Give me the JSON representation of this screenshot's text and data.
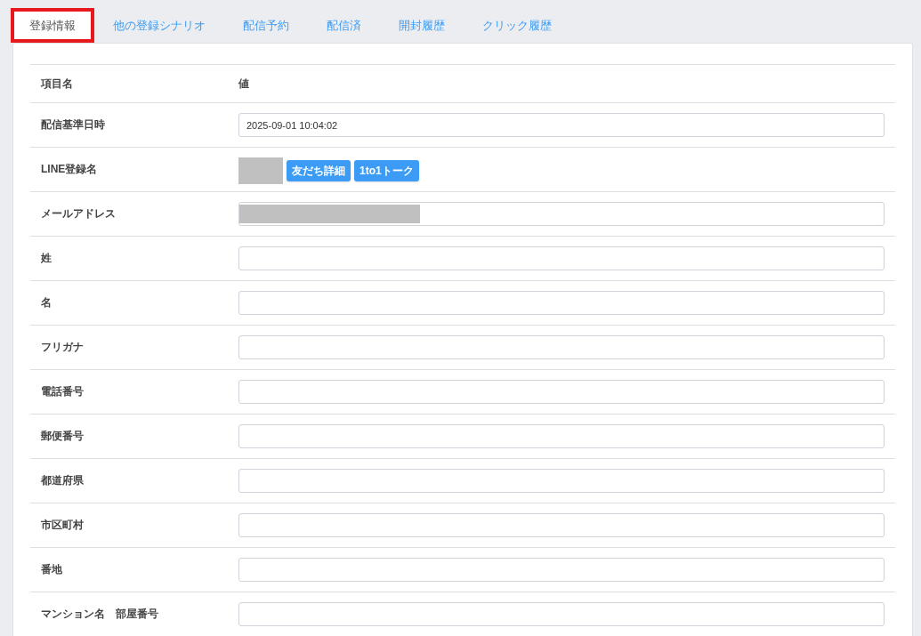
{
  "tabs": [
    {
      "label": "登録情報",
      "selected": true,
      "highlighted": true
    },
    {
      "label": "他の登録シナリオ",
      "selected": false,
      "highlighted": false
    },
    {
      "label": "配信予約",
      "selected": false,
      "highlighted": false
    },
    {
      "label": "配信済",
      "selected": false,
      "highlighted": false
    },
    {
      "label": "開封履歴",
      "selected": false,
      "highlighted": false
    },
    {
      "label": "クリック履歴",
      "selected": false,
      "highlighted": false
    }
  ],
  "table": {
    "columns": [
      "項目名",
      "値"
    ],
    "rows": [
      {
        "kind": "field",
        "label": "配信基準日時",
        "value": "2025-09-01 10:04:02"
      },
      {
        "kind": "line",
        "label": "LINE登録名",
        "buttons": [
          "友だち詳細",
          "1to1トーク"
        ]
      },
      {
        "kind": "redacted",
        "label": "メールアドレス"
      },
      {
        "kind": "field",
        "label": "姓",
        "value": ""
      },
      {
        "kind": "field",
        "label": "名",
        "value": ""
      },
      {
        "kind": "field",
        "label": "フリガナ",
        "value": ""
      },
      {
        "kind": "field",
        "label": "電話番号",
        "value": ""
      },
      {
        "kind": "field",
        "label": "郵便番号",
        "value": ""
      },
      {
        "kind": "field",
        "label": "都道府県",
        "value": ""
      },
      {
        "kind": "field",
        "label": "市区町村",
        "value": ""
      },
      {
        "kind": "field",
        "label": "番地",
        "value": ""
      },
      {
        "kind": "field",
        "label": "マンション名　部屋番号",
        "value": ""
      }
    ]
  }
}
